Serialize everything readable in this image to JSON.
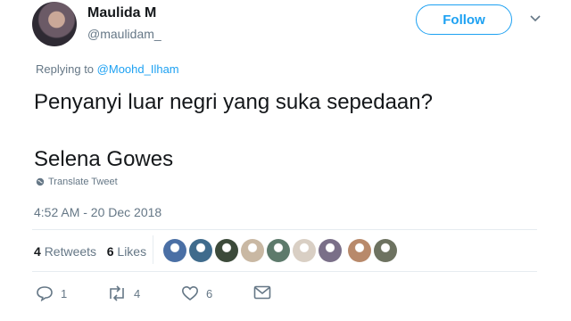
{
  "user": {
    "name": "Maulida M",
    "handle": "@maulidam_"
  },
  "follow_label": "Follow",
  "reply": {
    "prefix": "Replying to",
    "target": "@Moohd_Ilham"
  },
  "tweet": {
    "line1": "Penyanyi luar negri yang suka sepedaan?",
    "line2": "Selena Gowes"
  },
  "translate_label": "Translate Tweet",
  "timestamp": "4:52 AM - 20 Dec 2018",
  "stats": {
    "retweets_count": "4",
    "retweets_label": "Retweets",
    "likes_count": "6",
    "likes_label": "Likes"
  },
  "actions": {
    "reply_count": "1",
    "retweet_count": "4",
    "like_count": "6"
  },
  "liker_avatar_colors": [
    "#4a6fa5",
    "#3f6b8c",
    "#3c4a3a",
    "#c9b8a3",
    "#5d7a6b",
    "#d9cfc4",
    "#7a6f88",
    "#b8896a",
    "#6d7260"
  ],
  "colors": {
    "accent": "#1da1f2",
    "muted": "#657786",
    "text": "#14171a"
  }
}
